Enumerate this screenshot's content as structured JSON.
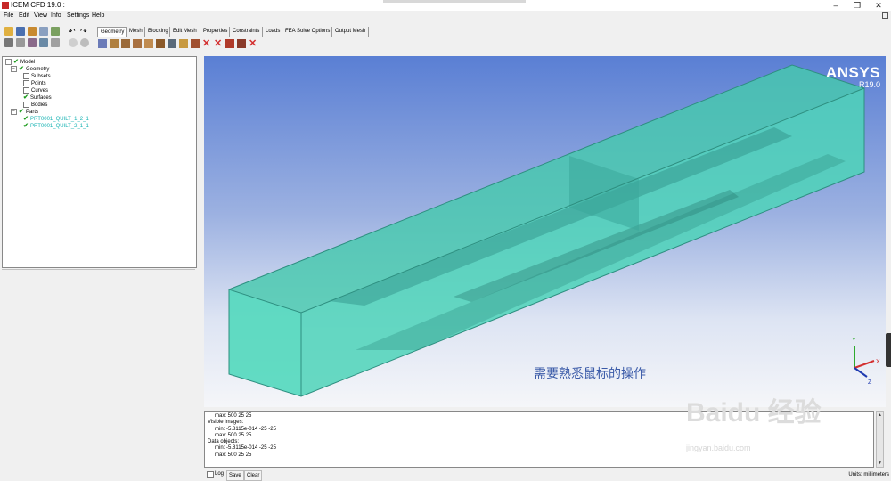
{
  "window": {
    "title": "ICEM CFD 19.0 :",
    "controls": [
      "–",
      "❐",
      "✕"
    ]
  },
  "menu": [
    "File",
    "Edit",
    "View",
    "Info",
    "Settings",
    "Help"
  ],
  "tabs": [
    "Geometry",
    "Mesh",
    "Blocking",
    "Edit Mesh",
    "Properties",
    "Constraints",
    "Loads",
    "FEA Solve Options",
    "Output Mesh"
  ],
  "tree": {
    "model": "Model",
    "geometry": "Geometry",
    "items": [
      {
        "label": "Subsets",
        "checked": false
      },
      {
        "label": "Points",
        "checked": false
      },
      {
        "label": "Curves",
        "checked": false
      },
      {
        "label": "Surfaces",
        "checked": true
      },
      {
        "label": "Bodies",
        "checked": false
      }
    ],
    "parts": "Parts",
    "part_items": [
      "PRT0001_QUILT_1_2_1",
      "PRT0001_QUILT_2_1_1"
    ]
  },
  "brand": {
    "name": "ANSYS",
    "version": "R19.0"
  },
  "overlay": "需要熟悉鼠标的操作",
  "axes": {
    "y": "Y",
    "x": "X",
    "z": "Z"
  },
  "console": {
    "lines": [
      {
        "text": "max: 500 25 25",
        "indent": true
      },
      {
        "text": "Visible images:",
        "indent": false
      },
      {
        "text": "min: -5.8115e-014 -25 -25",
        "indent": true
      },
      {
        "text": "max: 500 25 25",
        "indent": true
      },
      {
        "text": "Data objects:",
        "indent": false
      },
      {
        "text": "min: -5.8115e-014 -25 -25",
        "indent": true
      },
      {
        "text": "max: 500 25 25",
        "indent": true
      }
    ]
  },
  "bottom": {
    "log": "Log",
    "save": "Save",
    "clear": "Clear",
    "units": "Units: millimeters"
  },
  "watermark": {
    "main": "Baidu 经验",
    "sub": "jingyan.baidu.com"
  },
  "colors": {
    "model_fill": "#3fd3b6",
    "viewport_top": "#5a7fd4",
    "part_text": "#17b3b3",
    "ribbon_red": "#d32f2f"
  }
}
